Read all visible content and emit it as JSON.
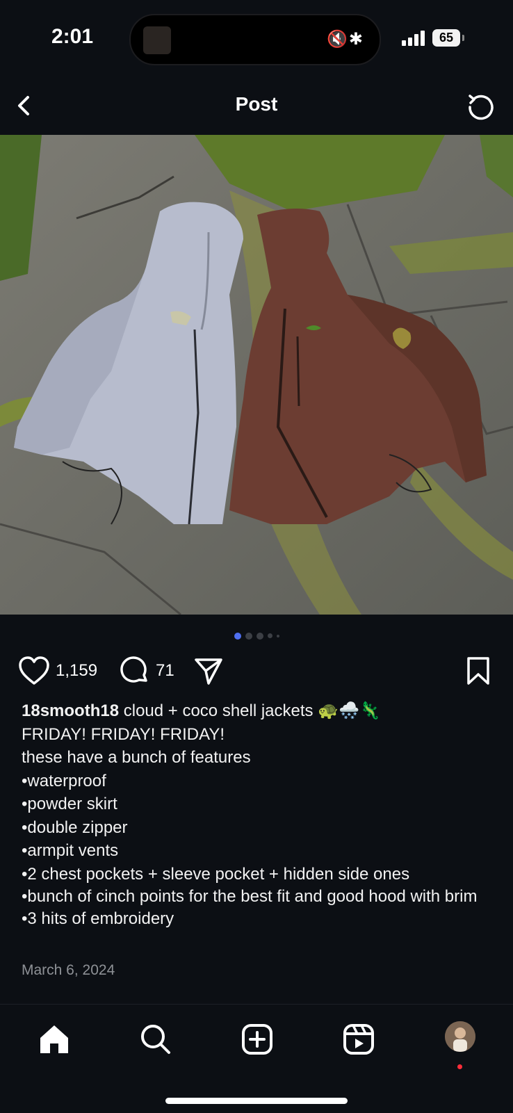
{
  "status_bar": {
    "time": "2:01",
    "battery": "65"
  },
  "header": {
    "title": "Post"
  },
  "post": {
    "carousel": {
      "count": 5,
      "active": 0
    },
    "likes": "1,159",
    "comments": "71",
    "username": "18smooth18",
    "caption_first": " cloud + coco shell jackets 🐢🌨️🦎",
    "caption_lines": [
      "FRIDAY! FRIDAY! FRIDAY!",
      "these have a bunch of features",
      "•waterproof",
      "•powder skirt",
      "•double zipper",
      "•armpit vents",
      "•2 chest pockets + sleeve pocket + hidden side ones",
      "•bunch of cinch points for the best fit and good hood with brim",
      "•3 hits of embroidery"
    ],
    "date": "March 6, 2024"
  },
  "colors": {
    "carousel_active": "#4f6ff0",
    "notification_dot": "#ff2d3a"
  }
}
